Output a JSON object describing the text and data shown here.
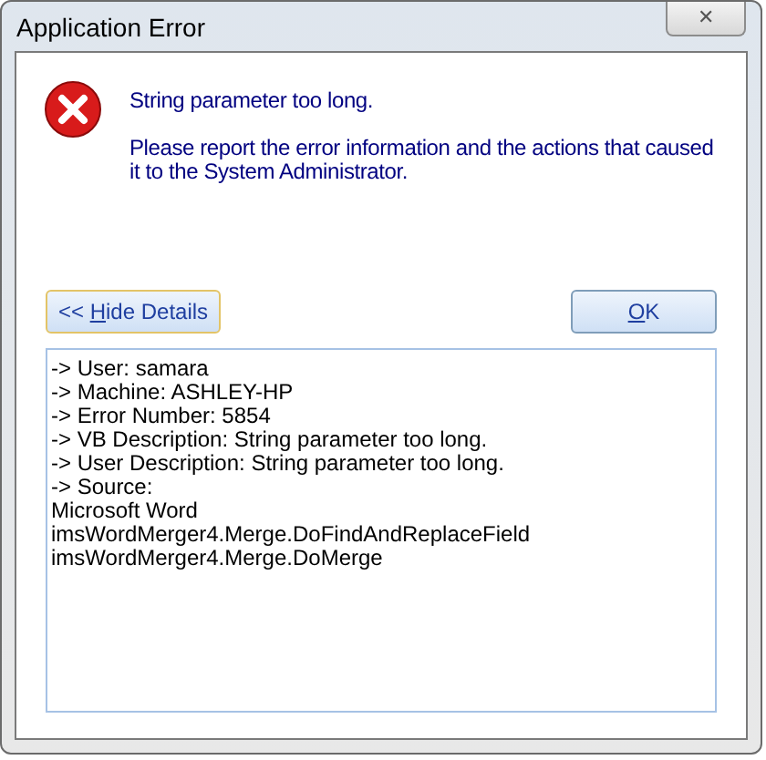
{
  "window": {
    "title": "Application Error",
    "close": "✕"
  },
  "message": {
    "kind": "error",
    "lines": [
      "String parameter too long.",
      "Please report the error information and the actions that caused it to the System Administrator."
    ]
  },
  "buttons": [
    {
      "before": "<< ",
      "accelerator": "H",
      "after": "ide Details",
      "focused": true
    },
    {
      "accelerator": "O",
      "after": "K",
      "focused": false
    }
  ],
  "details": [
    "-> User: samara",
    "-> Machine: ASHLEY-HP",
    "-> Error Number: 5854",
    "-> VB Description: String parameter too long.",
    "-> User Description: String parameter too long.",
    "-> Source:",
    "Microsoft Word",
    "imsWordMerger4.Merge.DoFindAndReplaceField",
    "imsWordMerger4.Merge.DoMerge"
  ]
}
